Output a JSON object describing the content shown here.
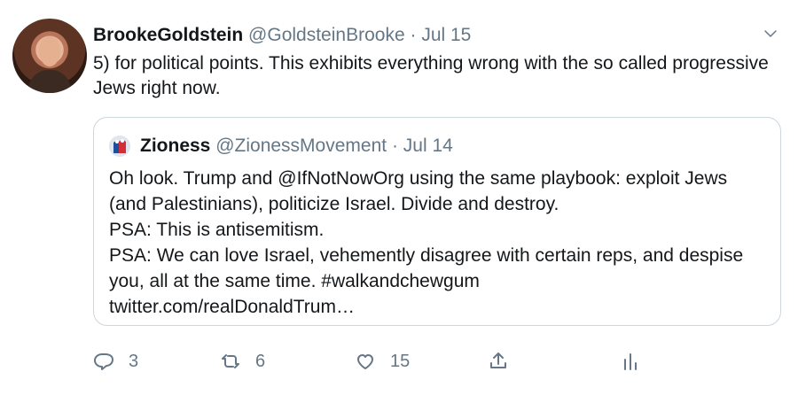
{
  "tweet": {
    "display_name": "BrookeGoldstein",
    "handle": "@GoldsteinBrooke",
    "separator": "·",
    "date": "Jul 15",
    "text": "5) for political points. This exhibits everything wrong with the so called progressive Jews right now."
  },
  "quoted_tweet": {
    "display_name": "Zioness",
    "handle": "@ZionessMovement",
    "separator": "·",
    "date": "Jul 14",
    "lines": [
      "Oh look. Trump and @IfNotNowOrg using the same playbook: exploit Jews (and Palestinians), politicize Israel. Divide and destroy.",
      "PSA: This is antisemitism.",
      "PSA: We can love Israel, vehemently disagree with certain reps, and despise you, all at the same time. #walkandchewgum",
      "twitter.com/realDonaldTrum…"
    ]
  },
  "actions": {
    "reply_count": "3",
    "retweet_count": "6",
    "like_count": "15"
  },
  "icons": [
    "chevron-down-icon",
    "reply-icon",
    "retweet-icon",
    "like-icon",
    "share-icon",
    "analytics-icon"
  ],
  "colors": {
    "text": "#14171a",
    "secondary": "#657786",
    "border": "#ccd6dd",
    "background": "#ffffff"
  }
}
